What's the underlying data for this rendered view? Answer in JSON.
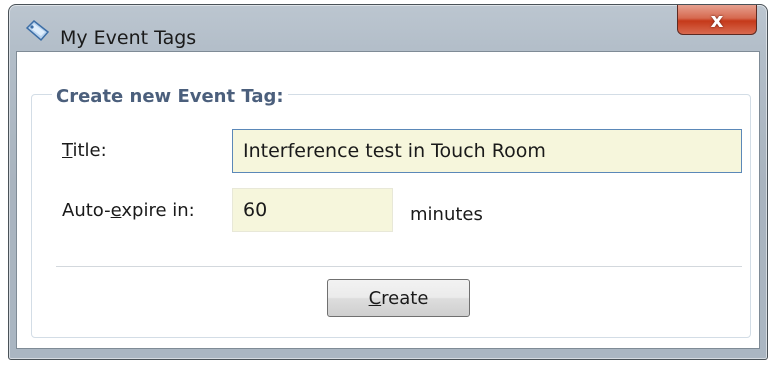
{
  "window": {
    "title": "My Event Tags",
    "icon": "tag-icon",
    "close_glyph": "x"
  },
  "group": {
    "legend": "Create new Event Tag:"
  },
  "title_field": {
    "label_access": "T",
    "label_rest": "itle:",
    "value": "Interference test in Touch Room"
  },
  "expire_field": {
    "label_before": "Auto-",
    "label_access": "e",
    "label_after": "xpire in:",
    "value": "60",
    "unit": "minutes"
  },
  "create_button": {
    "label_access": "C",
    "label_rest": "reate"
  },
  "colors": {
    "input_background": "#f6f6dc",
    "legend_text": "#4b5f7c",
    "close_button": "#c5391a"
  }
}
